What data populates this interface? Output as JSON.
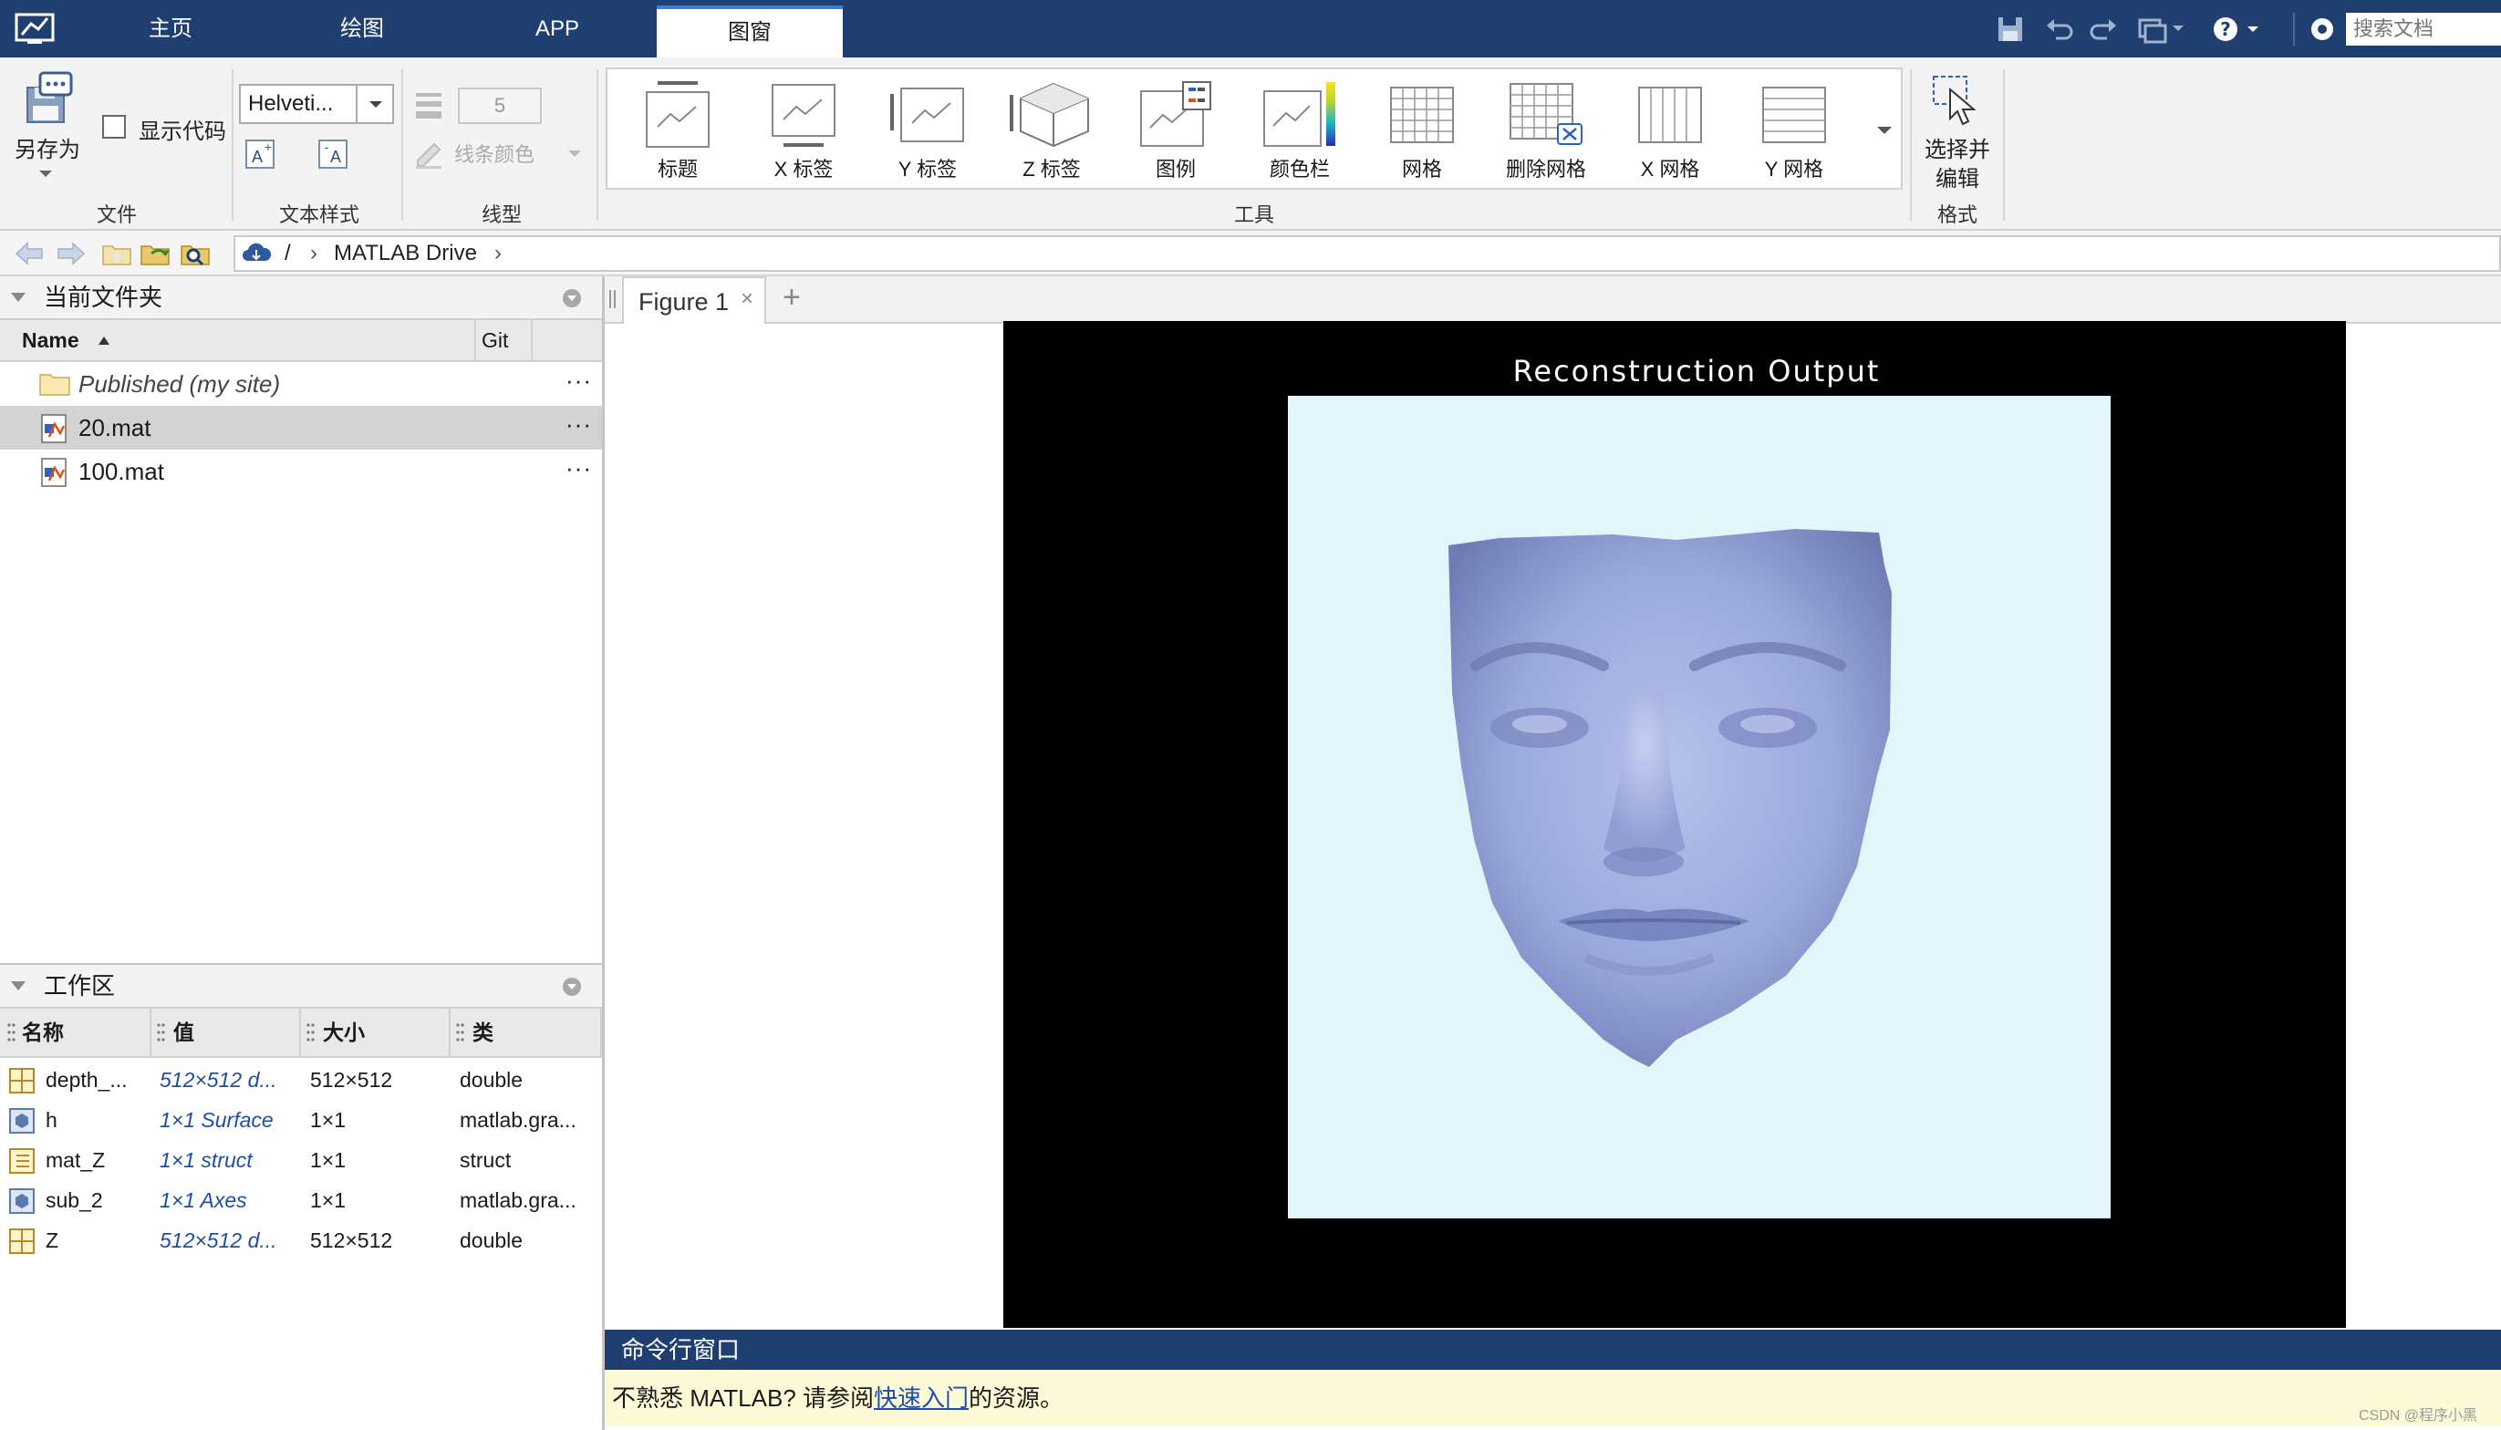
{
  "topbar": {
    "tabs": [
      "主页",
      "绘图",
      "APP"
    ],
    "active_tab": "图窗",
    "search_placeholder": "搜索文档",
    "icons": [
      "app-logo-icon",
      "save-icon",
      "undo-icon",
      "redo-icon",
      "window-layout-icon",
      "help-icon",
      "community-icon"
    ]
  },
  "ribbon": {
    "file": {
      "save_as": "另存为",
      "show_code": "显示代码",
      "section": "文件"
    },
    "text_style": {
      "font": "Helveti...",
      "section": "文本样式"
    },
    "line_style": {
      "width": "5",
      "line_color": "线条颜色",
      "section": "线型"
    },
    "tools": {
      "section": "工具",
      "items": [
        "标题",
        "X 标签",
        "Y 标签",
        "Z 标签",
        "图例",
        "颜色栏",
        "网格",
        "删除网格",
        "X 网格",
        "Y 网格"
      ]
    },
    "format": {
      "select_edit_line1": "选择并",
      "select_edit_line2": "编辑",
      "section": "格式"
    }
  },
  "address": {
    "root": "/",
    "folder": "MATLAB Drive"
  },
  "current_folder": {
    "title": "当前文件夹",
    "col_name": "Name",
    "col_git": "Git",
    "files": [
      {
        "name": "Published",
        "suffix": "(my site)",
        "dots": "···"
      },
      {
        "name": "20.mat",
        "dots": "···"
      },
      {
        "name": "100.mat",
        "dots": "···"
      }
    ]
  },
  "workspace": {
    "title": "工作区",
    "columns": [
      "名称",
      "值",
      "大小",
      "类"
    ],
    "rows": [
      {
        "name": "depth_...",
        "value": "512×512 d...",
        "size": "512×512",
        "class": "double"
      },
      {
        "name": "h",
        "value": "1×1 Surface",
        "size": "1×1",
        "class": "matlab.gra..."
      },
      {
        "name": "mat_Z",
        "value": "1×1 struct",
        "size": "1×1",
        "class": "struct"
      },
      {
        "name": "sub_2",
        "value": "1×1 Axes",
        "size": "1×1",
        "class": "matlab.gra..."
      },
      {
        "name": "Z",
        "value": "512×512 d...",
        "size": "512×512",
        "class": "double"
      }
    ]
  },
  "figure": {
    "tab": "Figure 1",
    "close": "×",
    "add": "+",
    "plot_title": "Reconstruction Output",
    "colors": {
      "background": "#000000",
      "axes": "#e2f5fb",
      "surface": "#9aa8dc"
    }
  },
  "command_window": {
    "title": "命令行窗口",
    "text_before": "不熟悉 MATLAB? 请参阅",
    "link": "快速入门",
    "text_after": "的资源。"
  },
  "watermark": "CSDN @程序小黑"
}
